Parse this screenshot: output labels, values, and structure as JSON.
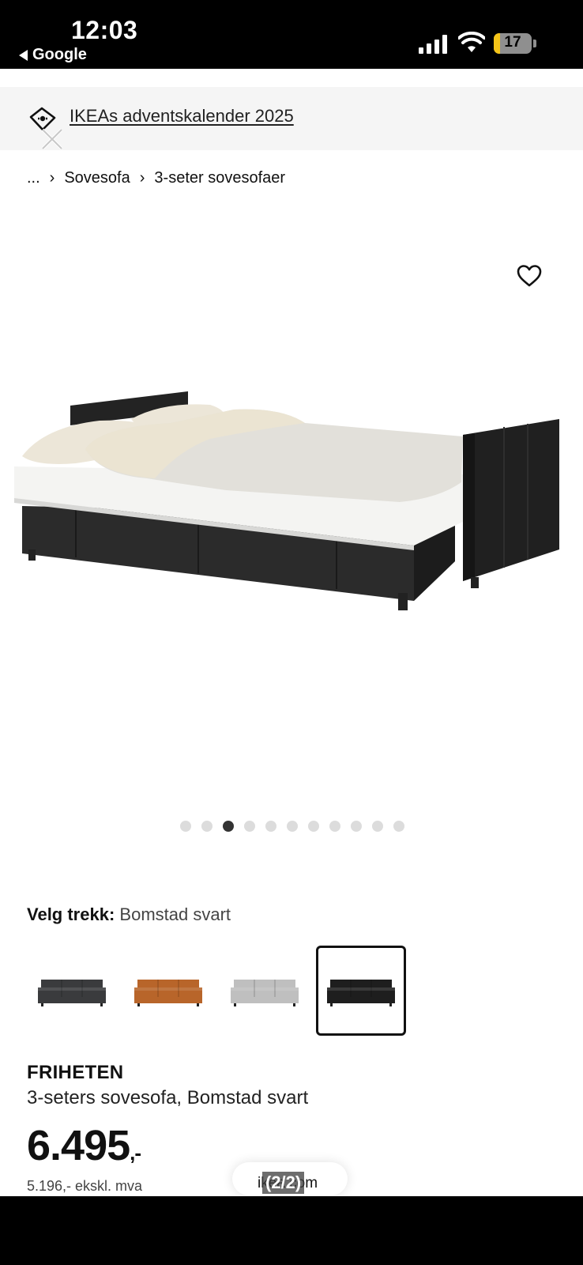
{
  "status_bar": {
    "time": "12:03",
    "back_app": "Google",
    "battery": "17",
    "battery_level_percent": 17
  },
  "banner": {
    "link_text": "IKEAs adventskalender 2025"
  },
  "breadcrumb": {
    "ellipsis": "...",
    "items": [
      "Sovesofa",
      "3-seter sovesofaer"
    ]
  },
  "gallery": {
    "dot_count": 11,
    "active_index": 2
  },
  "variant": {
    "label": "Velg trekk:",
    "selected": "Bomstad svart",
    "options": [
      {
        "icon": "sofa-dark-grey",
        "color": "#3a3b3d"
      },
      {
        "icon": "sofa-cognac",
        "color": "#b8652a"
      },
      {
        "icon": "sofa-light-grey",
        "color": "#bfbfbf"
      },
      {
        "icon": "sofa-black",
        "color": "#1e1e1e",
        "selected": true
      }
    ]
  },
  "product": {
    "name": "FRIHETEN",
    "description": "3-seters sovesofa, Bomstad svart",
    "price": "6.495",
    "price_suffix": ",-",
    "price_ex_vat": "5.196,- ekskl. mva"
  },
  "overlay": {
    "url_partial": "ikea.com",
    "pager": "(2/2)"
  }
}
